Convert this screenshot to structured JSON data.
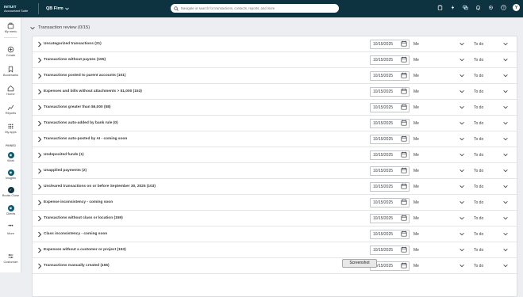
{
  "brand": {
    "line1": "INTUIT",
    "line2": "Accountant Suite"
  },
  "firm_selector": "QB Firm",
  "search": {
    "placeholder": "Navigate or search for transactions, contacts, reports, and more"
  },
  "user_initial": "Y",
  "sidebar": {
    "items": [
      {
        "label": "My menu",
        "icon": "briefcase-icon"
      },
      {
        "label": "Create",
        "icon": "plus-circle-icon"
      },
      {
        "label": "Bookmarks",
        "icon": "bookmark-icon"
      },
      {
        "label": "Home",
        "icon": "home-icon"
      },
      {
        "label": "Reports",
        "icon": "reports-icon"
      },
      {
        "label": "My apps",
        "icon": "apps-grid-icon"
      }
    ],
    "pinned_label": "PINNED",
    "pinned": [
      {
        "label": "Work",
        "icon": "work-icon"
      },
      {
        "label": "Insights",
        "icon": "insights-icon"
      },
      {
        "label": "Books Close",
        "icon": "check-icon"
      },
      {
        "label": "Clients",
        "icon": "clients-icon"
      }
    ],
    "more_label": "More",
    "customize_label": "Customize"
  },
  "section": {
    "title": "Transaction review (0/15)"
  },
  "rows": [
    {
      "label": "Uncategorized transactions (21)",
      "date": "10/15/2025",
      "assignee": "Me",
      "status": "To do"
    },
    {
      "label": "Transactions without payees (155)",
      "date": "10/15/2025",
      "assignee": "Me",
      "status": "To do"
    },
    {
      "label": "Transactions posted to parent accounts (101)",
      "date": "10/15/2025",
      "assignee": "Me",
      "status": "To do"
    },
    {
      "label": "Expenses and bills without attachments > $1,000 (153)",
      "date": "10/15/2025",
      "assignee": "Me",
      "status": "To do"
    },
    {
      "label": "Transactions greater than $6,000 (58)",
      "date": "10/15/2025",
      "assignee": "Me",
      "status": "To do"
    },
    {
      "label": "Transactions auto-added by bank rule (0)",
      "date": "10/15/2025",
      "assignee": "Me",
      "status": "To do"
    },
    {
      "label": "Transactions auto-posted by AI - coming soon",
      "date": "10/15/2025",
      "assignee": "Me",
      "status": "To do"
    },
    {
      "label": "Undeposited funds (1)",
      "date": "10/15/2025",
      "assignee": "Me",
      "status": "To do"
    },
    {
      "label": "Unapplied payments (2)",
      "date": "10/15/2025",
      "assignee": "Me",
      "status": "To do"
    },
    {
      "label": "Uncleared transactions on or before September 30, 2025 (103)",
      "date": "10/15/2025",
      "assignee": "Me",
      "status": "To do"
    },
    {
      "label": "Expense inconsistency - coming soon",
      "date": "10/15/2025",
      "assignee": "Me",
      "status": "To do"
    },
    {
      "label": "Transactions without class or location (159)",
      "date": "10/15/2025",
      "assignee": "Me",
      "status": "To do"
    },
    {
      "label": "Class inconsistency - coming soon",
      "date": "10/15/2025",
      "assignee": "Me",
      "status": "To do"
    },
    {
      "label": "Expenses without a customer or project (153)",
      "date": "10/15/2025",
      "assignee": "Me",
      "status": "To do"
    },
    {
      "label": "Transactions manually created (155)",
      "date": "10/15/2025",
      "assignee": "Me",
      "status": "To do"
    }
  ],
  "tooltip": "Screenshot"
}
